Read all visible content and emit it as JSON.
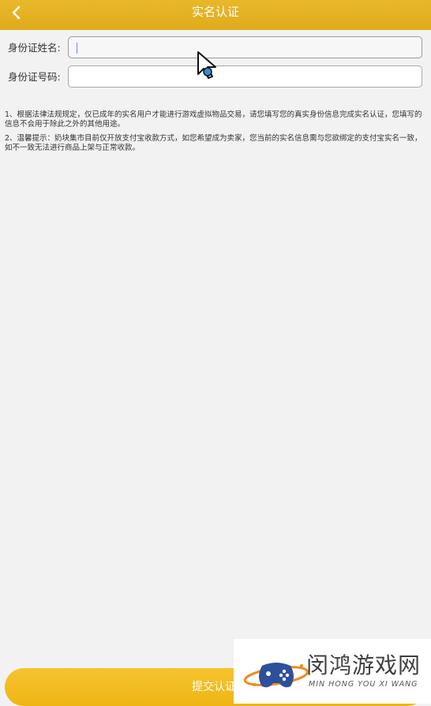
{
  "header": {
    "title": "实名认证",
    "back_icon": "chevron-left-icon"
  },
  "form": {
    "name_label": "身份证姓名:",
    "name_value": "",
    "id_label": "身份证号码:",
    "id_value": ""
  },
  "notes": [
    "1、根据法律法规规定，仅已成年的实名用户才能进行游戏虚拟物品交易，请您填写您的真实身份信息完成实名认证，您填写的信息不会用于除此之外的其他用途。",
    "2、温馨提示：奶块集市目前仅开放支付宝收款方式，如您希望成为卖家，您当前的实名信息需与您欲绑定的支付宝实名一致，如不一致无法进行商品上架与正常收款。"
  ],
  "submit": {
    "label": "提交认证"
  },
  "watermark": {
    "name": "闵鸿游戏网",
    "sub": "MIN HONG YOU XI WANG"
  },
  "colors": {
    "header": "#e2b022",
    "button": "#f2bd22",
    "background": "#f2f2f2"
  }
}
